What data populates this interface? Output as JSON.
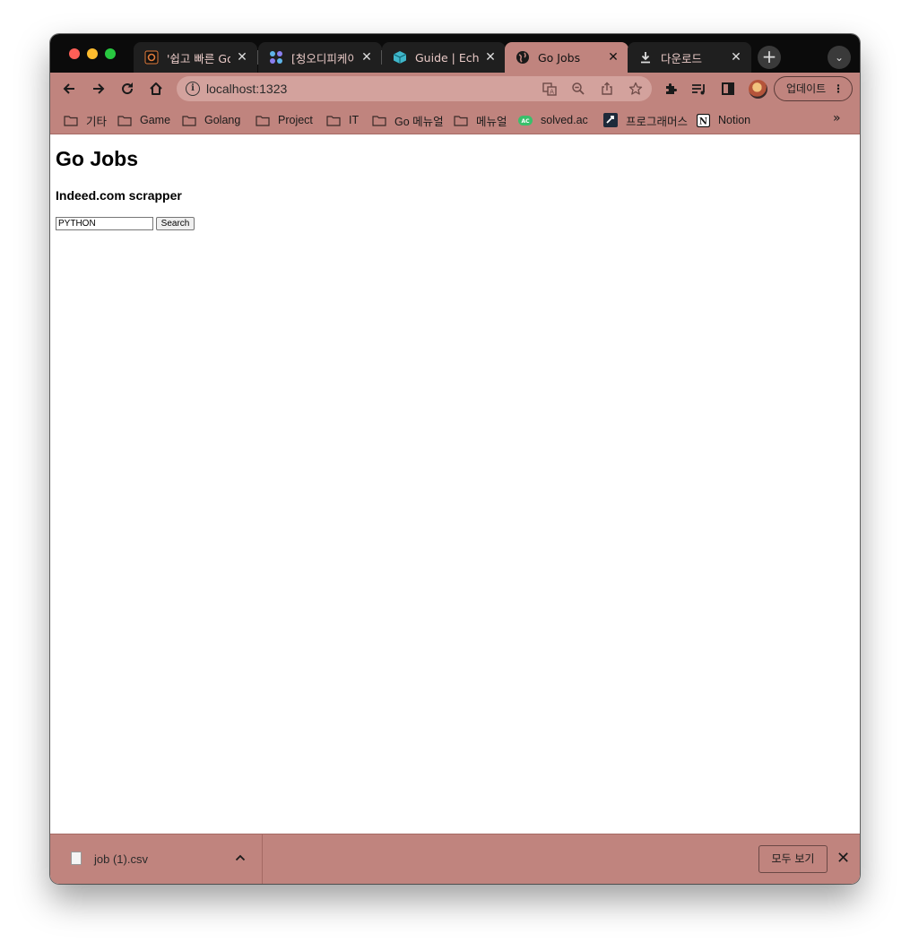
{
  "browser": {
    "tabs": [
      {
        "title": "'쉽고 빠른 Go",
        "favicon": "nomadcoders-icon",
        "active": false
      },
      {
        "title": "[청오디피케이(",
        "favicon": "dots-grid-icon",
        "active": false
      },
      {
        "title": "Guide | Echo",
        "favicon": "echo-cube-icon",
        "active": false
      },
      {
        "title": "Go Jobs",
        "favicon": "globe-icon",
        "active": true
      },
      {
        "title": "다운로드",
        "favicon": "download-icon",
        "active": false
      }
    ],
    "address": "localhost:1323",
    "update_label": "업데이트",
    "bookmarks": [
      {
        "label": "기타",
        "icon": "folder-icon"
      },
      {
        "label": "Game",
        "icon": "folder-icon"
      },
      {
        "label": "Golang",
        "icon": "folder-icon"
      },
      {
        "label": "Project",
        "icon": "folder-icon"
      },
      {
        "label": "IT",
        "icon": "folder-icon"
      },
      {
        "label": "Go 메뉴얼",
        "icon": "folder-icon"
      },
      {
        "label": "메뉴얼",
        "icon": "folder-icon"
      },
      {
        "label": "solved.ac",
        "icon": "solvedac-icon"
      },
      {
        "label": "프로그래머스",
        "icon": "programmers-icon"
      },
      {
        "label": "Notion",
        "icon": "notion-icon"
      }
    ],
    "bookmarks_more": "»"
  },
  "page": {
    "heading": "Go Jobs",
    "subheading": "Indeed.com scrapper",
    "search": {
      "value": "PYTHON",
      "button_label": "Search"
    }
  },
  "downloads": {
    "file_name": "job (1).csv",
    "show_all_label": "모두 보기"
  },
  "colors": {
    "frame": "#c0847e",
    "tabstrip": "#0b0b0b",
    "omnibox": "#d3a29d"
  }
}
